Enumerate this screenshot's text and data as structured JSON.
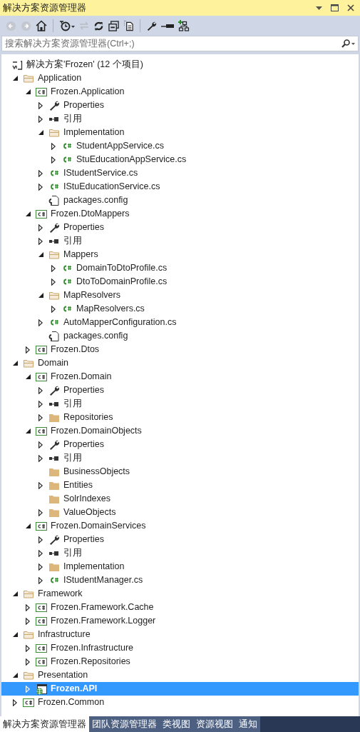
{
  "window": {
    "title": "解决方案资源管理器"
  },
  "search": {
    "placeholder": "搜索解决方案资源管理器(Ctrl+;)"
  },
  "tree": {
    "solution": {
      "label": "解决方案'Frozen' (12 个项目)",
      "selected": false
    },
    "items": [
      {
        "label": "Application",
        "kind": "solution-folder",
        "expanded": true,
        "selected": false,
        "children": [
          {
            "label": "Frozen.Application",
            "kind": "project",
            "expanded": true,
            "selected": false,
            "children": [
              {
                "label": "Properties",
                "kind": "properties",
                "expanded": false,
                "selected": false
              },
              {
                "label": "引用",
                "kind": "references",
                "expanded": false,
                "selected": false
              },
              {
                "label": "Implementation",
                "kind": "folder",
                "expanded": true,
                "selected": false,
                "children": [
                  {
                    "label": "StudentAppService.cs",
                    "kind": "cs",
                    "expanded": false,
                    "selected": false
                  },
                  {
                    "label": "StuEducationAppService.cs",
                    "kind": "cs",
                    "expanded": false,
                    "selected": false
                  }
                ]
              },
              {
                "label": "IStudentService.cs",
                "kind": "cs",
                "expanded": false,
                "selected": false
              },
              {
                "label": "IStuEducationService.cs",
                "kind": "cs",
                "expanded": false,
                "selected": false
              },
              {
                "label": "packages.config",
                "kind": "config",
                "selected": false
              }
            ]
          },
          {
            "label": "Frozen.DtoMappers",
            "kind": "project",
            "expanded": true,
            "selected": false,
            "children": [
              {
                "label": "Properties",
                "kind": "properties",
                "expanded": false,
                "selected": false
              },
              {
                "label": "引用",
                "kind": "references",
                "expanded": false,
                "selected": false
              },
              {
                "label": "Mappers",
                "kind": "folder",
                "expanded": true,
                "selected": false,
                "children": [
                  {
                    "label": "DomainToDtoProfile.cs",
                    "kind": "cs",
                    "expanded": false,
                    "selected": false
                  },
                  {
                    "label": "DtoToDomainProfile.cs",
                    "kind": "cs",
                    "expanded": false,
                    "selected": false
                  }
                ]
              },
              {
                "label": "MapResolvers",
                "kind": "folder",
                "expanded": true,
                "selected": false,
                "children": [
                  {
                    "label": "MapResolvers.cs",
                    "kind": "cs",
                    "expanded": false,
                    "selected": false
                  }
                ]
              },
              {
                "label": "AutoMapperConfiguration.cs",
                "kind": "cs",
                "expanded": false,
                "selected": false
              },
              {
                "label": "packages.config",
                "kind": "config",
                "selected": false
              }
            ]
          },
          {
            "label": "Frozen.Dtos",
            "kind": "project",
            "expanded": false,
            "selected": false
          }
        ]
      },
      {
        "label": "Domain",
        "kind": "solution-folder",
        "expanded": true,
        "selected": false,
        "children": [
          {
            "label": "Frozen.Domain",
            "kind": "project",
            "expanded": true,
            "selected": false,
            "children": [
              {
                "label": "Properties",
                "kind": "properties",
                "expanded": false,
                "selected": false
              },
              {
                "label": "引用",
                "kind": "references",
                "expanded": false,
                "selected": false
              },
              {
                "label": "Repositories",
                "kind": "folder",
                "expanded": false,
                "selected": false
              }
            ]
          },
          {
            "label": "Frozen.DomainObjects",
            "kind": "project",
            "expanded": true,
            "selected": false,
            "children": [
              {
                "label": "Properties",
                "kind": "properties",
                "expanded": false,
                "selected": false
              },
              {
                "label": "引用",
                "kind": "references",
                "expanded": false,
                "selected": false
              },
              {
                "label": "BusinessObjects",
                "kind": "folder",
                "selected": false
              },
              {
                "label": "Entities",
                "kind": "folder",
                "expanded": false,
                "selected": false
              },
              {
                "label": "SolrIndexes",
                "kind": "folder",
                "selected": false
              },
              {
                "label": "ValueObjects",
                "kind": "folder",
                "expanded": false,
                "selected": false
              }
            ]
          },
          {
            "label": "Frozen.DomainServices",
            "kind": "project",
            "expanded": true,
            "selected": false,
            "children": [
              {
                "label": "Properties",
                "kind": "properties",
                "expanded": false,
                "selected": false
              },
              {
                "label": "引用",
                "kind": "references",
                "expanded": false,
                "selected": false
              },
              {
                "label": "Implementation",
                "kind": "folder",
                "expanded": false,
                "selected": false
              },
              {
                "label": "IStudentManager.cs",
                "kind": "cs",
                "expanded": false,
                "selected": false
              }
            ]
          }
        ]
      },
      {
        "label": "Framework",
        "kind": "solution-folder",
        "expanded": true,
        "selected": false,
        "children": [
          {
            "label": "Frozen.Framework.Cache",
            "kind": "project",
            "expanded": false,
            "selected": false
          },
          {
            "label": "Frozen.Framework.Logger",
            "kind": "project",
            "expanded": false,
            "selected": false
          }
        ]
      },
      {
        "label": "Infrastructure",
        "kind": "solution-folder",
        "expanded": true,
        "selected": false,
        "children": [
          {
            "label": "Frozen.Infrastructure",
            "kind": "project",
            "expanded": false,
            "selected": false
          },
          {
            "label": "Frozen.Repositories",
            "kind": "project",
            "expanded": false,
            "selected": false
          }
        ]
      },
      {
        "label": "Presentation",
        "kind": "solution-folder",
        "expanded": true,
        "selected": false,
        "children": [
          {
            "label": "Frozen.API",
            "kind": "web-project",
            "expanded": false,
            "selected": true
          }
        ]
      },
      {
        "label": "Frozen.Common",
        "kind": "project",
        "expanded": false,
        "selected": false
      }
    ]
  },
  "tabs": [
    {
      "label": "解决方案资源管理器",
      "selected": true
    },
    {
      "label": "团队资源管理器",
      "selected": false
    },
    {
      "label": "类视图",
      "selected": false
    },
    {
      "label": "资源视图",
      "selected": false
    },
    {
      "label": "通知",
      "selected": false
    }
  ]
}
